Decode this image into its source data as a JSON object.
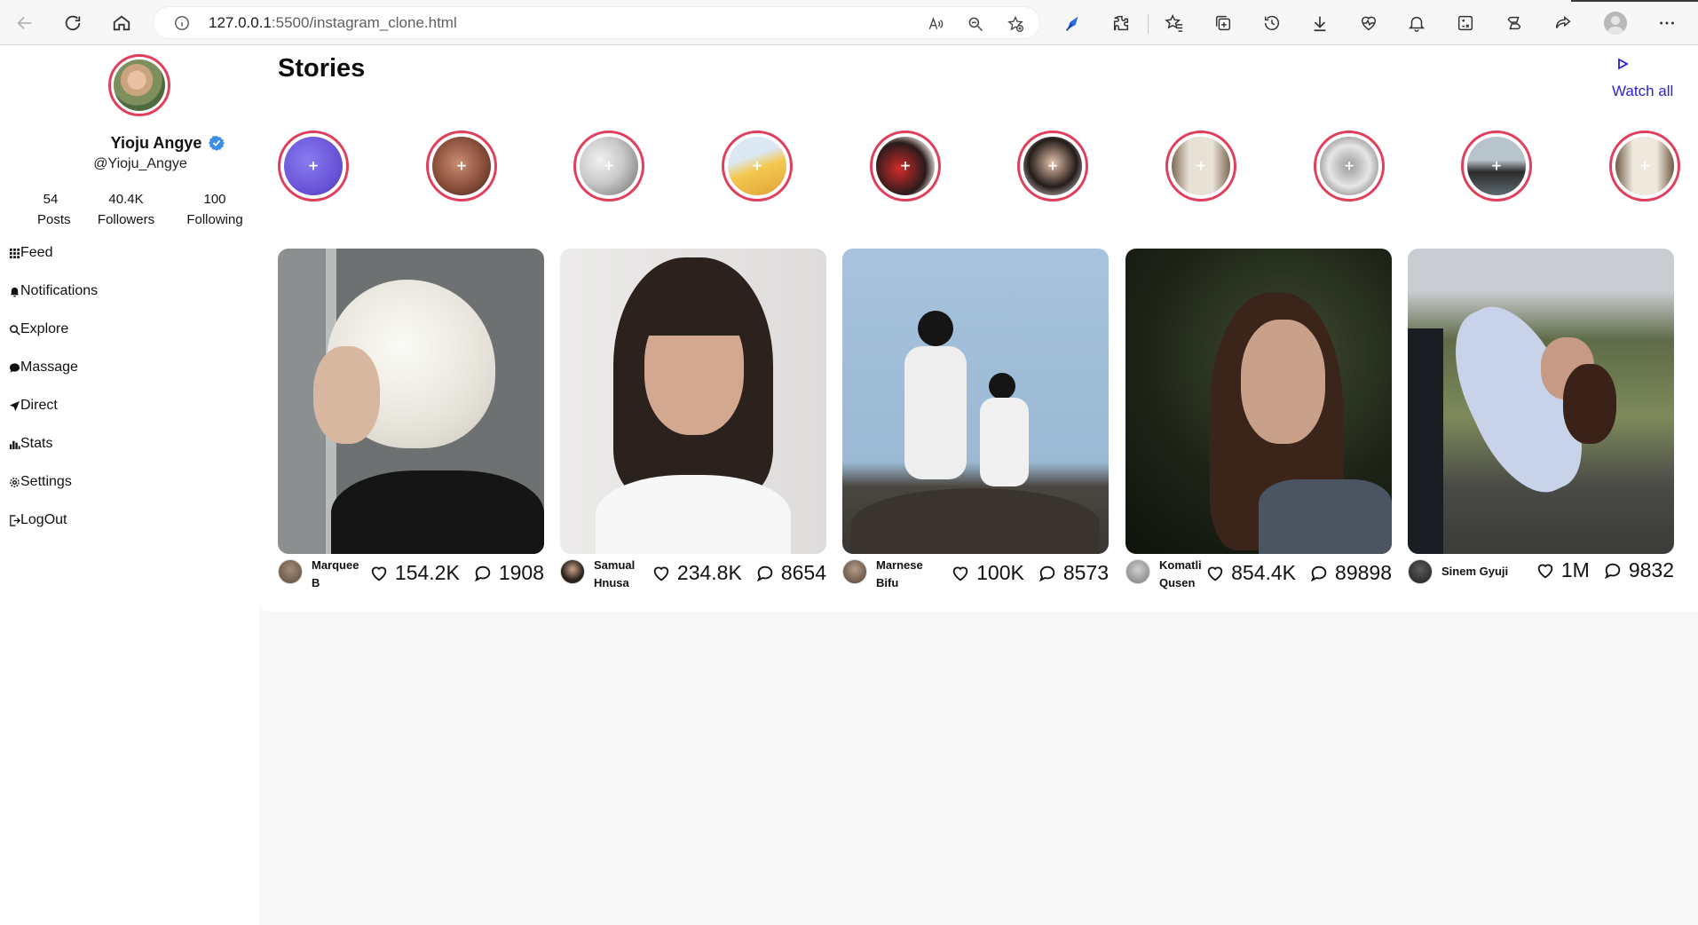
{
  "browser": {
    "url_host": "127.0.0.1",
    "url_path": ":5500/instagram_clone.html",
    "accent_color": "#3a3a3a"
  },
  "profile": {
    "name": "Yioju Angye",
    "handle": "@Yioju_Angye",
    "verified_icon": "verified-badge-icon",
    "stats": [
      {
        "value": "54",
        "label": "Posts"
      },
      {
        "value": "40.4K",
        "label": "Followers"
      },
      {
        "value": "100",
        "label": "Following"
      }
    ]
  },
  "nav": [
    {
      "label": "Feed",
      "icon": "grid-icon"
    },
    {
      "label": "Notifications",
      "icon": "bell-icon"
    },
    {
      "label": "Explore",
      "icon": "search-icon"
    },
    {
      "label": "Massage",
      "icon": "chat-bubble-icon"
    },
    {
      "label": "Direct",
      "icon": "send-icon"
    },
    {
      "label": "Stats",
      "icon": "bar-chart-icon"
    },
    {
      "label": "Settings",
      "icon": "gear-icon"
    },
    {
      "label": "LogOut",
      "icon": "logout-icon"
    }
  ],
  "stories": {
    "title": "Stories",
    "watch_all": "Watch all",
    "ring_color": "#e13e5c",
    "link_color": "#2a1fd6",
    "count": 10
  },
  "posts": [
    {
      "author_line1": "Marquee",
      "author_line2": "B",
      "likes": "154.2K",
      "comments": "1908"
    },
    {
      "author_line1": "Samual",
      "author_line2": "Hnusa",
      "likes": "234.8K",
      "comments": "8654"
    },
    {
      "author_line1": "Marnese",
      "author_line2": "Bifu",
      "likes": "100K",
      "comments": "8573"
    },
    {
      "author_line1": "Komatli",
      "author_line2": "Qusen",
      "likes": "854.4K",
      "comments": "89898"
    },
    {
      "author_line1": "Sinem Gyuji",
      "author_line2": "",
      "likes": "1M",
      "comments": "9832"
    }
  ]
}
